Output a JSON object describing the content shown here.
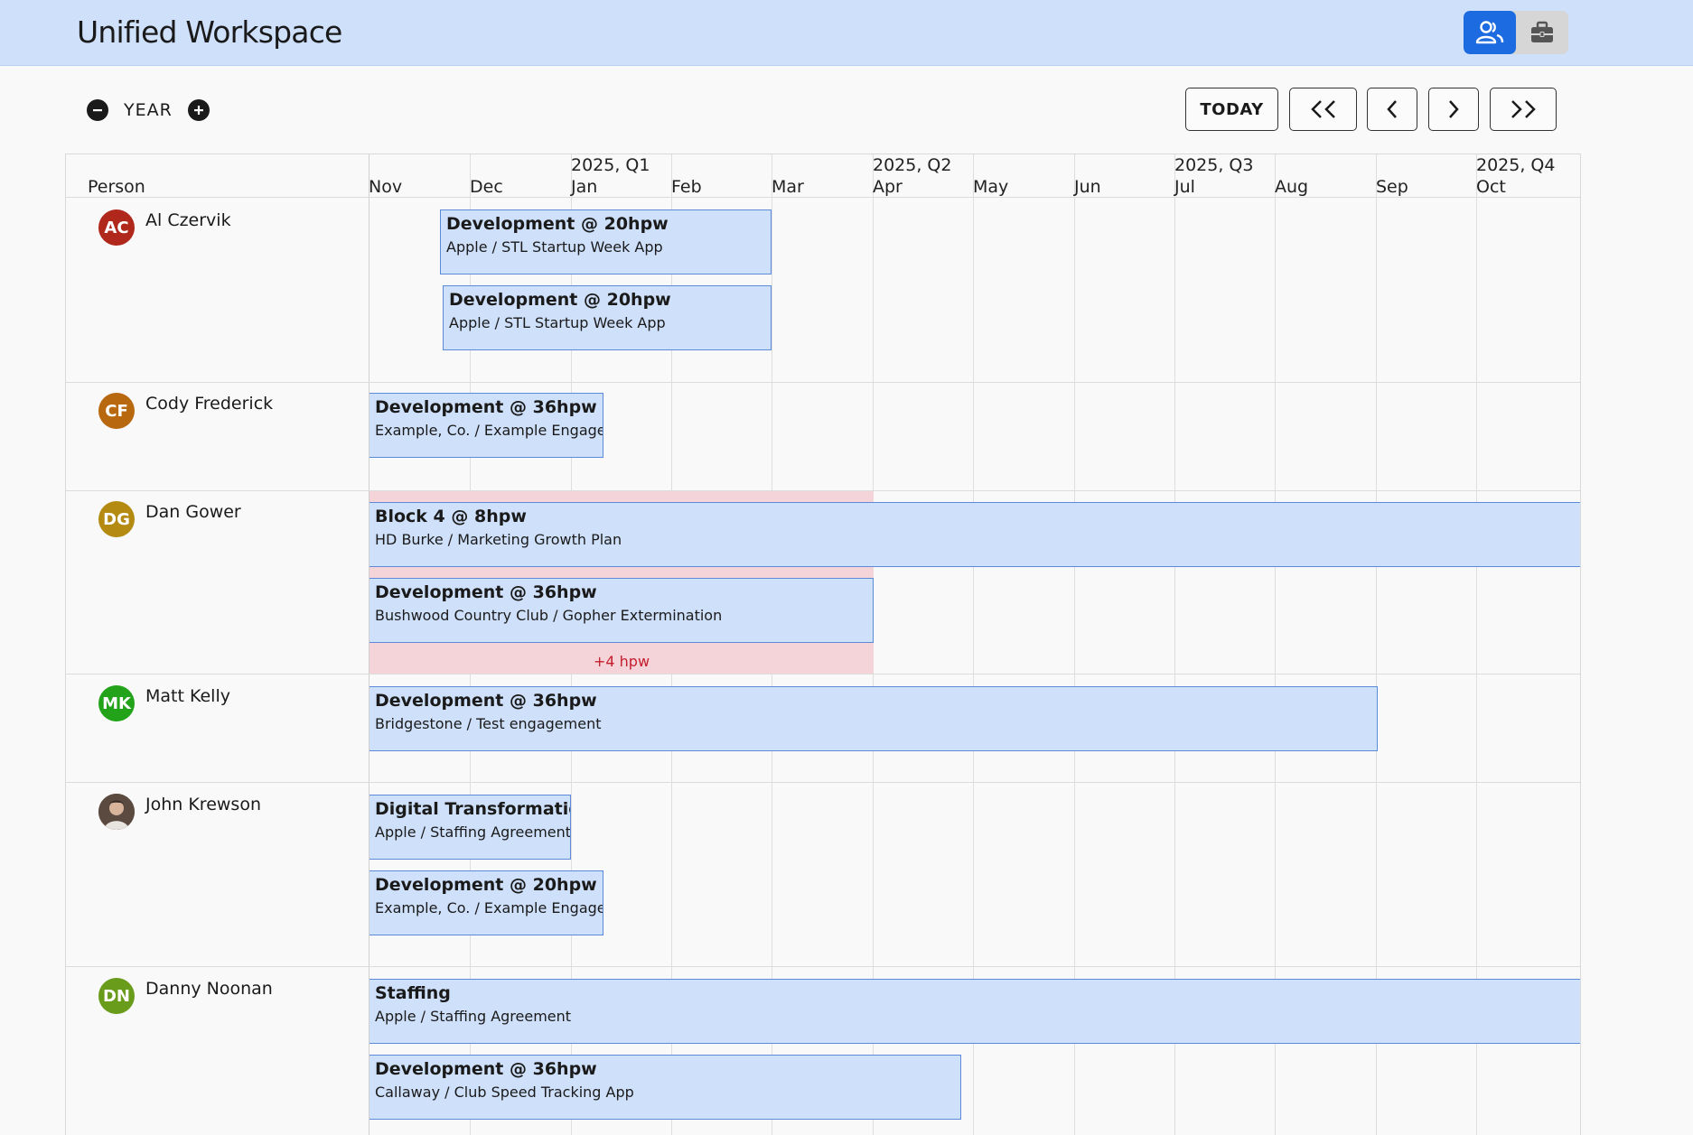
{
  "app": {
    "title": "Unified Workspace"
  },
  "view_toggle": {
    "active": "people-icon",
    "inactive": "briefcase-icon"
  },
  "zoom": {
    "label": "YEAR",
    "decrease": "−",
    "increase": "+"
  },
  "nav": {
    "today": "TODAY",
    "jump_back": "<<",
    "back": "<",
    "forward": ">",
    "jump_forward": ">>"
  },
  "header": {
    "person_label": "Person",
    "months": [
      "Nov",
      "Dec",
      "Jan",
      "Feb",
      "Mar",
      "Apr",
      "May",
      "Jun",
      "Jul",
      "Aug",
      "Sep",
      "Oct"
    ],
    "quarters": [
      "2025, Q1",
      "2025, Q2",
      "2025, Q3",
      "2025, Q4"
    ]
  },
  "people": [
    {
      "name": "Al Czervik",
      "initials": "AC",
      "color": "#b0281b",
      "assignments": [
        {
          "title": "Development @ 20hpw",
          "subtitle": "Apple / STL Startup Week App"
        },
        {
          "title": "Development @ 20hpw",
          "subtitle": "Apple / STL Startup Week App"
        }
      ]
    },
    {
      "name": "Cody Frederick",
      "initials": "CF",
      "color": "#b8680f",
      "assignments": [
        {
          "title": "Development @ 36hpw",
          "subtitle": "Example, Co. / Example Engagement"
        }
      ]
    },
    {
      "name": "Dan Gower",
      "initials": "DG",
      "color": "#b58a10",
      "overallocation": "+4 hpw",
      "assignments": [
        {
          "title": "Block 4 @ 8hpw",
          "subtitle": "HD Burke / Marketing Growth Plan"
        },
        {
          "title": "Development @ 36hpw",
          "subtitle": "Bushwood Country Club / Gopher Extermination"
        }
      ]
    },
    {
      "name": "Matt Kelly",
      "initials": "MK",
      "color": "#23a31a",
      "assignments": [
        {
          "title": "Development @ 36hpw",
          "subtitle": "Bridgestone / Test engagement"
        }
      ]
    },
    {
      "name": "John Krewson",
      "initials": "",
      "color": "#6b5a4e",
      "assignments": [
        {
          "title": "Digital Transformation @",
          "subtitle": "Apple / Staffing Agreement"
        },
        {
          "title": "Development @ 20hpw",
          "subtitle": "Example, Co. / Example Engagement"
        }
      ]
    },
    {
      "name": "Danny Noonan",
      "initials": "DN",
      "color": "#6a9c1c",
      "assignments": [
        {
          "title": "Staffing",
          "subtitle": "Apple / Staffing Agreement"
        },
        {
          "title": "Development @ 36hpw",
          "subtitle": "Callaway / Club Speed Tracking App"
        }
      ]
    }
  ]
}
